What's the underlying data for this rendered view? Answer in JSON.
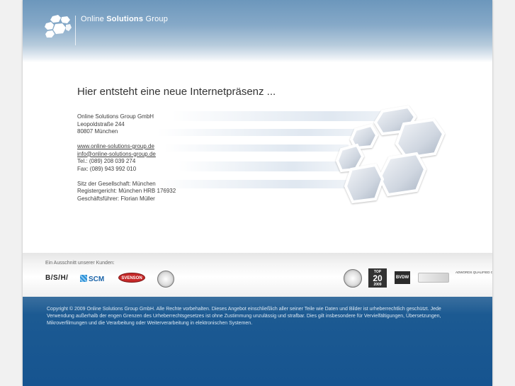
{
  "header": {
    "company_prefix": "Online ",
    "company_bold": "Solutions",
    "company_suffix": " Group"
  },
  "main": {
    "headline": "Hier entsteht eine neue Internetpräsenz ...",
    "address": {
      "company": "Online Solutions Group GmbH",
      "street": "Leopoldstraße 244",
      "city": "80807 München"
    },
    "web": "www.online-solutions-group.de",
    "email": "info@online-solutions-group.de",
    "phone": "Tel.: (089) 208 039 274",
    "fax": "Fax: (089) 943 992 010",
    "seat": "Sitz der Gesellschaft: München",
    "register": "Registergericht: München HRB 176932",
    "ceo": "Geschäftsführer: Florian Müller"
  },
  "clients": {
    "label": "Ein Ausschnitt unserer Kunden:",
    "logos": [
      "B/S/H/",
      "SCM",
      "SVENSON"
    ]
  },
  "partners": {
    "top20_label": "TOP",
    "top20_number": "20",
    "top20_year": "2009",
    "bvdw": "BVDW",
    "adwords": "ADWORDS QUALIFIED COMPANY Google"
  },
  "footer": {
    "copyright": "Copyright © 2009 Online Solutions Group GmbH. Alle Rechte vorbehalten. Dieses Angebot einschließlich aller seiner Teile wie Daten und Bilder ist urheberrechtlich geschützt. Jede Verwendung außerhalb der engen Grenzen des Urheberrechtsgesetzes ist ohne Zustimmung unzulässig und strafbar. Dies gilt insbesondere für Vervielfältigungen, Übersetzungen, Mikroverfilmungen und die Verarbeitung oder Weiterverarbeitung in elektronischen Systemen."
  },
  "colors": {
    "header_blue": "#6c97bc",
    "footer_blue": "#165490",
    "text": "#333333"
  }
}
